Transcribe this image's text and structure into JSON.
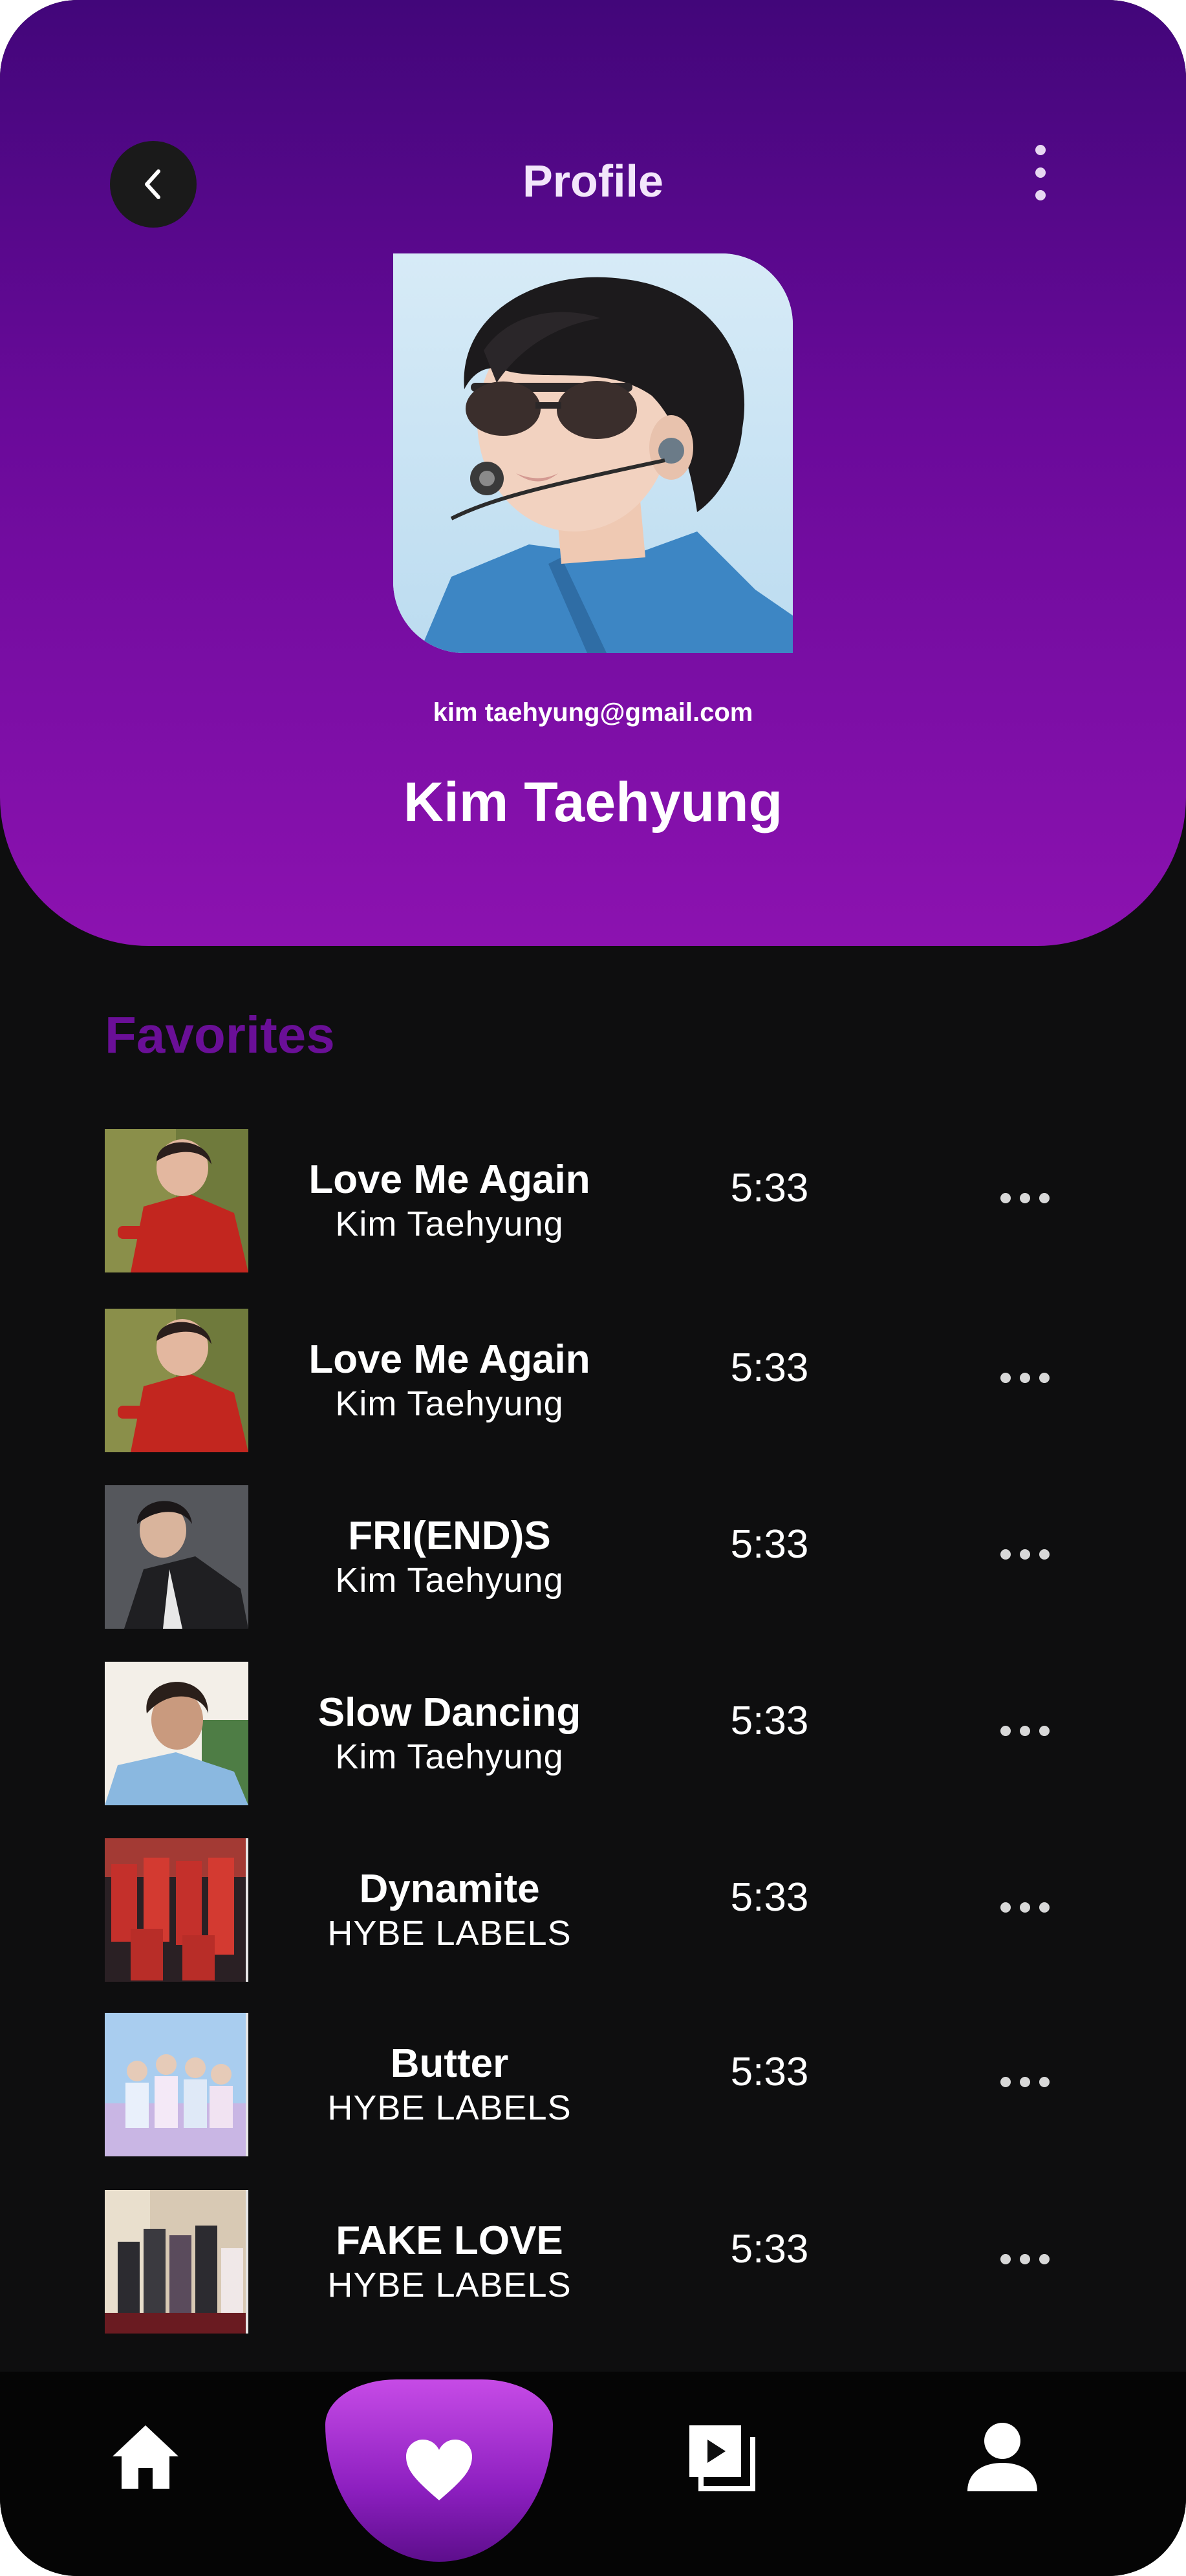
{
  "header": {
    "title": "Profile",
    "email": "kim taehyung@gmail.com",
    "name": "Kim Taehyung"
  },
  "favorites": {
    "heading": "Favorites",
    "tracks": [
      {
        "title": "Love Me Again",
        "artist": "Kim Taehyung",
        "duration": "5:33",
        "thumb": "red-portrait"
      },
      {
        "title": "Love Me Again",
        "artist": "Kim Taehyung",
        "duration": "5:33",
        "thumb": "red-portrait"
      },
      {
        "title": "FRI(END)S",
        "artist": "Kim Taehyung",
        "duration": "5:33",
        "thumb": "suit-portrait"
      },
      {
        "title": "Slow Dancing",
        "artist": "Kim Taehyung",
        "duration": "5:33",
        "thumb": "denim-portrait"
      },
      {
        "title": "Dynamite",
        "artist": "HYBE LABELS",
        "duration": "5:33",
        "thumb": "group-red"
      },
      {
        "title": "Butter",
        "artist": "HYBE LABELS",
        "duration": "5:33",
        "thumb": "group-pastel"
      },
      {
        "title": "FAKE LOVE",
        "artist": "HYBE LABELS",
        "duration": "5:33",
        "thumb": "group-dark"
      }
    ]
  },
  "nav": {
    "items": [
      "home-icon",
      "heart-icon",
      "playlist-icon",
      "user-icon"
    ],
    "active": "heart-icon"
  },
  "colors": {
    "header_top": "#42067a",
    "header_bottom": "#8c12b0",
    "accent_heading": "#6a0f97",
    "background": "#0e0e0f",
    "nav_background": "#050505"
  }
}
